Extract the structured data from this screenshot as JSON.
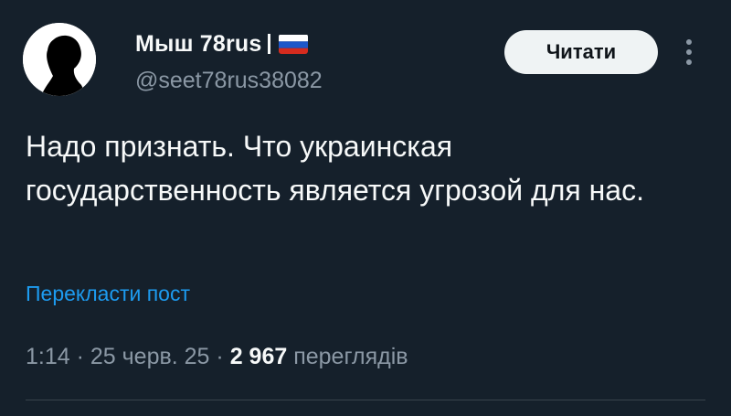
{
  "author": {
    "display_name": "Мыш 78rus",
    "handle": "@seet78rus38082",
    "flag_icon": "russia-flag-icon"
  },
  "actions": {
    "read_label": "Читати",
    "more_icon": "vertical-ellipsis-icon"
  },
  "post": {
    "text": "Надо признать. Что украинская государственность является угрозой для нас.",
    "translate_label": "Перекласти пост"
  },
  "meta": {
    "time": "1:14",
    "separator": " · ",
    "date": "25 черв. 25",
    "views_count": "2 967",
    "views_label": "переглядів"
  },
  "colors": {
    "background": "#15202b",
    "text": "#f7f9f9",
    "secondary_text": "#8b98a5",
    "link": "#1d9bf0",
    "button_bg": "#eff3f4"
  }
}
